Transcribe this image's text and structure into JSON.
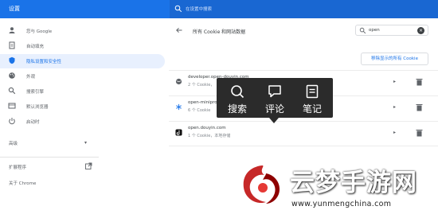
{
  "app": {
    "title": "设置"
  },
  "search": {
    "placeholder": "在设置中搜索",
    "icon": "search-icon"
  },
  "sidebar": {
    "items": [
      {
        "label": "您与 Google",
        "icon": "person-icon"
      },
      {
        "label": "自动填充",
        "icon": "document-icon"
      },
      {
        "label": "隐私设置和安全性",
        "icon": "shield-icon",
        "active": true
      },
      {
        "label": "外观",
        "icon": "palette-icon"
      },
      {
        "label": "搜索引擎",
        "icon": "search-icon"
      },
      {
        "label": "默认浏览器",
        "icon": "browser-icon"
      },
      {
        "label": "启动时",
        "icon": "power-icon"
      }
    ],
    "advanced": {
      "label": "高级",
      "icon": "chevron-down-icon"
    },
    "extensions": {
      "label": "扩展程序",
      "icon": "open-in-new-icon"
    },
    "about": {
      "label": "关于 Chrome"
    }
  },
  "main": {
    "title": "所有 Cookie 和网站数据",
    "filter": {
      "value": "open"
    },
    "remove_all_label": "移除显示的所有 Cookie",
    "sites": [
      {
        "host": "developer.open-douyin.com",
        "detail": "2 个 Cookie，"
      },
      {
        "host": "open-minipro",
        "detail": "6 个 Cookie"
      },
      {
        "host": "open.douyin.com",
        "detail": "1 个 Cookie，本地存储"
      }
    ]
  },
  "popup": {
    "buttons": [
      {
        "label": "搜索",
        "icon": "search-icon"
      },
      {
        "label": "评论",
        "icon": "comment-icon"
      },
      {
        "label": "笔记",
        "icon": "note-icon"
      }
    ]
  },
  "watermark": {
    "name": "云梦手游网",
    "url": "www.yunmengchina.com"
  },
  "colors": {
    "accent": "#1a73e8",
    "topbar": "#1a73e8",
    "popup_bg": "#2b2b2b"
  }
}
